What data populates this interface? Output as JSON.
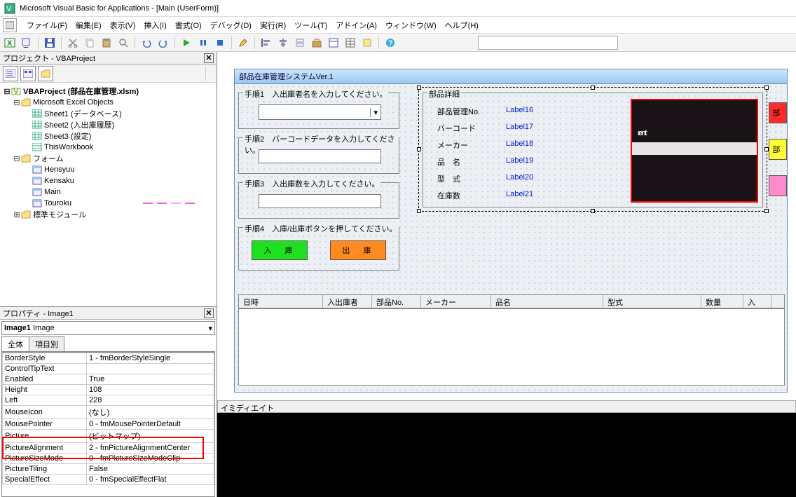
{
  "title": "Microsoft Visual Basic for Applications - [Main (UserForm)]",
  "menus": [
    "ファイル(F)",
    "編集(E)",
    "表示(V)",
    "挿入(I)",
    "書式(O)",
    "デバッグ(D)",
    "実行(R)",
    "ツール(T)",
    "アドイン(A)",
    "ウィンドウ(W)",
    "ヘルプ(H)"
  ],
  "project_pane_title": "プロジェクト - VBAProject",
  "tree": {
    "root": "VBAProject (部品在庫管理.xlsm)",
    "excel_objects": "Microsoft Excel Objects",
    "sheets": [
      "Sheet1 (データベース)",
      "Sheet2 (入出庫履歴)",
      "Sheet3 (設定)",
      "ThisWorkbook"
    ],
    "forms_label": "フォーム",
    "forms": [
      "Hensyuu",
      "Kensaku",
      "Main",
      "Touroku"
    ],
    "modules_label": "標準モジュール"
  },
  "properties_pane_title": "プロパティ - Image1",
  "prop_object_name": "Image1",
  "prop_object_type": "Image",
  "prop_tabs": [
    "全体",
    "項目別"
  ],
  "props": [
    [
      "BorderStyle",
      "1 - fmBorderStyleSingle"
    ],
    [
      "ControlTipText",
      ""
    ],
    [
      "Enabled",
      "True"
    ],
    [
      "Height",
      "108"
    ],
    [
      "Left",
      "228"
    ],
    [
      "MouseIcon",
      "(なし)"
    ],
    [
      "MousePointer",
      "0 - fmMousePointerDefault"
    ],
    [
      "Picture",
      "(ビットマップ)"
    ],
    [
      "PictureAlignment",
      "2 - fmPictureAlignmentCenter"
    ],
    [
      "PictureSizeMode",
      "0 - fmPictureSizeModeClip"
    ],
    [
      "PictureTiling",
      "False"
    ],
    [
      "SpecialEffect",
      "0 - fmSpecialEffectFlat"
    ]
  ],
  "form": {
    "title": "部品在庫管理システムVer.1",
    "step1": "手順1　入出庫者名を入力してください。",
    "step2": "手順2　バーコードデータを入力してください。",
    "step3": "手順3　入出庫数を入力してください。",
    "step4": "手順4　入庫/出庫ボタンを押してください。",
    "in_btn": "入　庫",
    "out_btn": "出　庫",
    "detail_legend": "部品詳細",
    "detail_rows": [
      [
        "部品管理No.",
        "Label16"
      ],
      [
        "バーコード",
        "Label17"
      ],
      [
        "メーカー",
        "Label18"
      ],
      [
        "品　名",
        "Label19"
      ],
      [
        "型　式",
        "Label20"
      ],
      [
        "在庫数",
        "Label21"
      ]
    ],
    "side_btn1": "部",
    "side_btn2": "部",
    "side_btn3": "　",
    "list_headers": [
      "日時",
      "入出庫者",
      "部品No.",
      "メーカー",
      "品名",
      "型式",
      "数量",
      "入"
    ]
  },
  "immediate_title": "イミディエイト"
}
